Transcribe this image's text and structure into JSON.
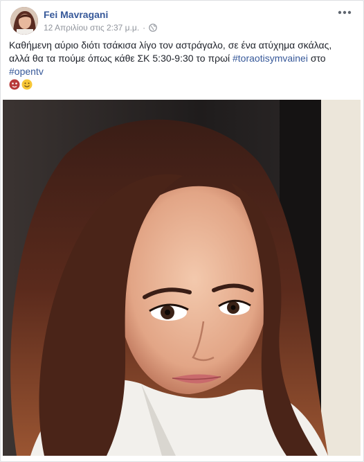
{
  "post": {
    "author": "Fei Mavragani",
    "timestamp": "12 Απριλίου στις 2:37 μ.μ.",
    "separator": "·",
    "audience_icon": "globe-icon",
    "more_icon": "more-options-icon",
    "text": {
      "line_part_1": "Καθήμενη αύριο διότι τσάκισα λίγο τον αστράγαλο, σε ένα ατύχημα σκάλας, αλλά θα τα πούμε όπως κάθε ΣΚ 5:30-9:30 το πρωί ",
      "hashtag_1": "#toraotisymvainei",
      "line_part_2": " στο ",
      "hashtag_2": "#opentv"
    },
    "emojis": [
      "red-heart-face-emoji",
      "smiling-face-emoji"
    ],
    "photo_alt": "selfie photo"
  },
  "colors": {
    "link": "#365899",
    "meta": "#90949c",
    "text": "#1d2129",
    "background": "#e9ebee"
  }
}
